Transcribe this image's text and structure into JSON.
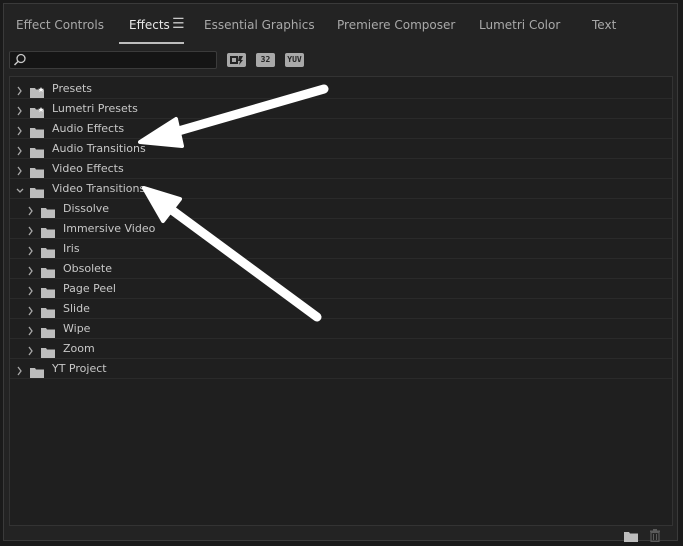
{
  "tabs": [
    {
      "label": "Effect Controls"
    },
    {
      "label": "Effects"
    },
    {
      "label": "Essential Graphics"
    },
    {
      "label": "Premiere Composer"
    },
    {
      "label": "Lumetri Color"
    },
    {
      "label": "Text"
    }
  ],
  "active_tab": "Effects",
  "search": {
    "value": "",
    "placeholder": ""
  },
  "filters": [
    {
      "label": "",
      "icon": "accelerated-effects-icon"
    },
    {
      "label": "32",
      "icon": "32-bit-color-icon"
    },
    {
      "label": "YUV",
      "icon": "yuv-effects-icon"
    }
  ],
  "tree": [
    {
      "label": "Presets",
      "level": 0,
      "expanded": false,
      "icon": "preset-folder-icon"
    },
    {
      "label": "Lumetri Presets",
      "level": 0,
      "expanded": false,
      "icon": "preset-folder-icon"
    },
    {
      "label": "Audio Effects",
      "level": 0,
      "expanded": false,
      "icon": "folder-icon"
    },
    {
      "label": "Audio Transitions",
      "level": 0,
      "expanded": false,
      "icon": "folder-icon"
    },
    {
      "label": "Video Effects",
      "level": 0,
      "expanded": false,
      "icon": "folder-icon"
    },
    {
      "label": "Video Transitions",
      "level": 0,
      "expanded": true,
      "icon": "folder-icon"
    },
    {
      "label": "Dissolve",
      "level": 1,
      "expanded": false,
      "icon": "folder-icon"
    },
    {
      "label": "Immersive Video",
      "level": 1,
      "expanded": false,
      "icon": "folder-icon"
    },
    {
      "label": "Iris",
      "level": 1,
      "expanded": false,
      "icon": "folder-icon"
    },
    {
      "label": "Obsolete",
      "level": 1,
      "expanded": false,
      "icon": "folder-icon"
    },
    {
      "label": "Page Peel",
      "level": 1,
      "expanded": false,
      "icon": "folder-icon"
    },
    {
      "label": "Slide",
      "level": 1,
      "expanded": false,
      "icon": "folder-icon"
    },
    {
      "label": "Wipe",
      "level": 1,
      "expanded": false,
      "icon": "folder-icon"
    },
    {
      "label": "Zoom",
      "level": 1,
      "expanded": false,
      "icon": "folder-icon"
    },
    {
      "label": "YT Project",
      "level": 0,
      "expanded": false,
      "icon": "folder-icon"
    }
  ],
  "footer": {
    "icons": [
      "new-bin-icon",
      "trash-icon"
    ]
  },
  "colors": {
    "panel": "#232323",
    "list": "#1f1f1f",
    "text": "#c8c8c8",
    "arrow": "#ffffff"
  }
}
